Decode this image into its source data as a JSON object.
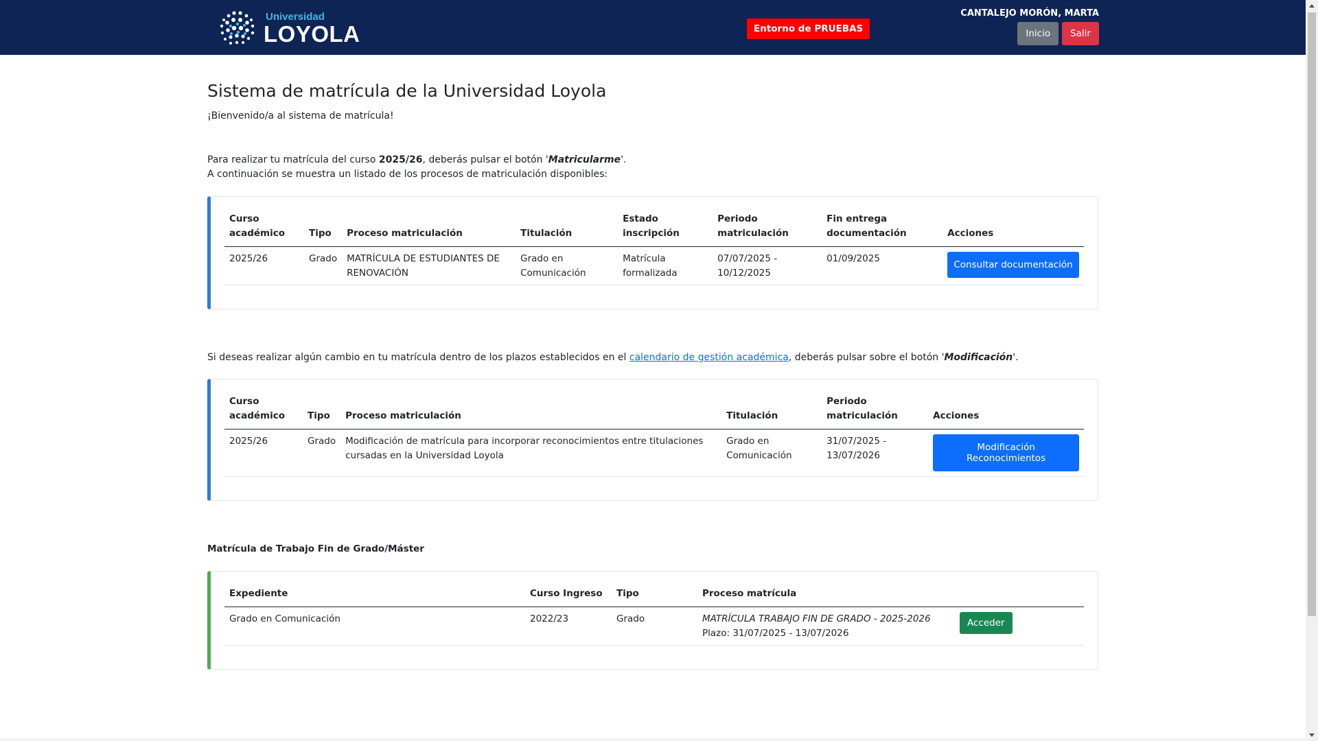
{
  "header": {
    "logo_small": "Universidad",
    "logo_big": "LOYOLA",
    "env_badge": "Entorno de PRUEBAS",
    "user_name": "CANTALEJO MORÓN, MARTA",
    "btn_home": "Inicio",
    "btn_logout": "Salir",
    "colors": {
      "bar": "#0d2454",
      "badge": "#ff0000",
      "home": "#6c757d",
      "logout": "#dc3545"
    }
  },
  "page": {
    "title": "Sistema de matrícula de la Universidad Loyola",
    "welcome": "¡Bienvenido/a al sistema de matrícula!",
    "intro_part1": "Para realizar tu matrícula del curso ",
    "intro_course": "2025/26",
    "intro_part2": ", deberás pulsar el botón '",
    "intro_button": "Matricularme",
    "intro_part3": "'.",
    "intro_line2": "A continuación se muestra un listado de los procesos de matriculación disponibles:"
  },
  "table1": {
    "headers": [
      "Curso académico",
      "Tipo",
      "Proceso matriculación",
      "Titulación",
      "Estado inscripción",
      "Periodo matriculación",
      "Fin entrega documentación",
      "Acciones"
    ],
    "row": {
      "curso": "2025/26",
      "tipo": "Grado",
      "proceso": "MATRÍCULA DE ESTUDIANTES DE RENOVACIÓN",
      "titulacion": "Grado en Comunicación",
      "estado": "Matrícula formalizada",
      "periodo": "07/07/2025 - 10/12/2025",
      "fin": "01/09/2025",
      "action": "Consultar documentación"
    }
  },
  "modif": {
    "text1": "Si deseas realizar algún cambio en tu matrícula dentro de los plazos establecidos en el ",
    "link": "calendario de gestión académica",
    "text2": ", deberás pulsar sobre el botón '",
    "button": "Modificación",
    "text3": "'."
  },
  "table2": {
    "headers": [
      "Curso académico",
      "Tipo",
      "Proceso matriculación",
      "Titulación",
      "Periodo matriculación",
      "Acciones"
    ],
    "row": {
      "curso": "2025/26",
      "tipo": "Grado",
      "proceso": "Modificación de matrícula para incorporar reconocimientos entre titulaciones cursadas en la Universidad Loyola",
      "titulacion": "Grado en Comunicación",
      "periodo": "31/07/2025 - 13/07/2026",
      "action": "Modificación Reconocimientos"
    }
  },
  "tfg": {
    "title": "Matrícula de Trabajo Fin de Grado/Máster",
    "headers": [
      "Expediente",
      "Curso Ingreso",
      "Tipo",
      "Proceso matrícula",
      ""
    ],
    "row": {
      "expediente": "Grado en Comunicación",
      "curso": "2022/23",
      "tipo": "Grado",
      "proceso": "MATRÍCULA TRABAJO FIN DE GRADO - 2025-2026",
      "plazo": "Plazo: 31/07/2025 - 13/07/2026",
      "action": "Acceder"
    }
  }
}
